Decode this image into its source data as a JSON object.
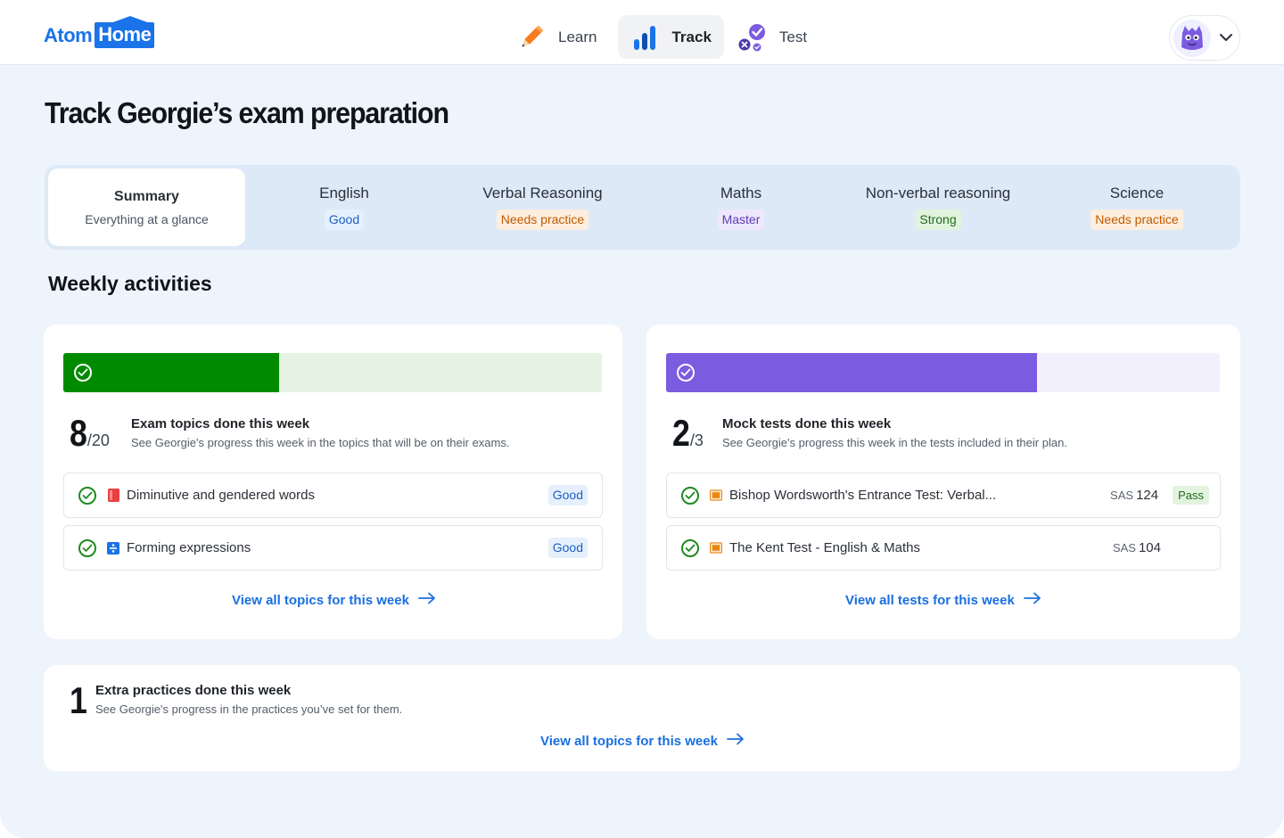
{
  "brand": {
    "part1": "Atom",
    "part2": "Home"
  },
  "nav": {
    "learn": "Learn",
    "track": "Track",
    "test": "Test"
  },
  "page_title": "Track Georgie’s exam preparation",
  "tabs": {
    "summary": {
      "title": "Summary",
      "subtitle": "Everything at a glance"
    },
    "english": {
      "title": "English",
      "status": "Good"
    },
    "verbal": {
      "title": "Verbal Reasoning",
      "status": "Needs practice"
    },
    "maths": {
      "title": "Maths",
      "status": "Master"
    },
    "nonverbal": {
      "title": "Non-verbal reasoning",
      "status": "Strong"
    },
    "science": {
      "title": "Science",
      "status": "Needs practice"
    }
  },
  "section_title": "Weekly activities",
  "topics_card": {
    "progress": 0.4,
    "count": "8",
    "total": "/20",
    "heading": "Exam topics done this week",
    "description": "See Georgie's progress this week in the topics that will be on their exams.",
    "items": [
      {
        "label": "Diminutive and gendered words",
        "status": "Good",
        "subject_icon": "english-book-icon"
      },
      {
        "label": "Forming expressions",
        "status": "Good",
        "subject_icon": "maths-divide-icon"
      }
    ],
    "link": "View all topics for this week"
  },
  "tests_card": {
    "progress": 0.67,
    "count": "2",
    "total": "/3",
    "heading": "Mock tests done this week",
    "description": "See Georgie's progress this week in the tests included in their plan.",
    "items": [
      {
        "label": "Bishop Wordsworth's Entrance Test: Verbal...",
        "sas_label": "SAS",
        "sas_value": "124",
        "result": "Pass"
      },
      {
        "label": "The Kent Test - English & Maths",
        "sas_label": "SAS",
        "sas_value": "104"
      }
    ],
    "link": "View all tests for this week"
  },
  "extra_card": {
    "count": "1",
    "heading": "Extra practices done this week",
    "description": "See Georgie's progress in the practices you’ve set for them.",
    "link": "View all topics for this week"
  },
  "colors": {
    "accent": "#1a73e8",
    "topics_fill": "#008a00",
    "topics_track": "#e6f3e4",
    "tests_fill": "#7b5ce0",
    "tests_track": "#f2f0fc"
  }
}
